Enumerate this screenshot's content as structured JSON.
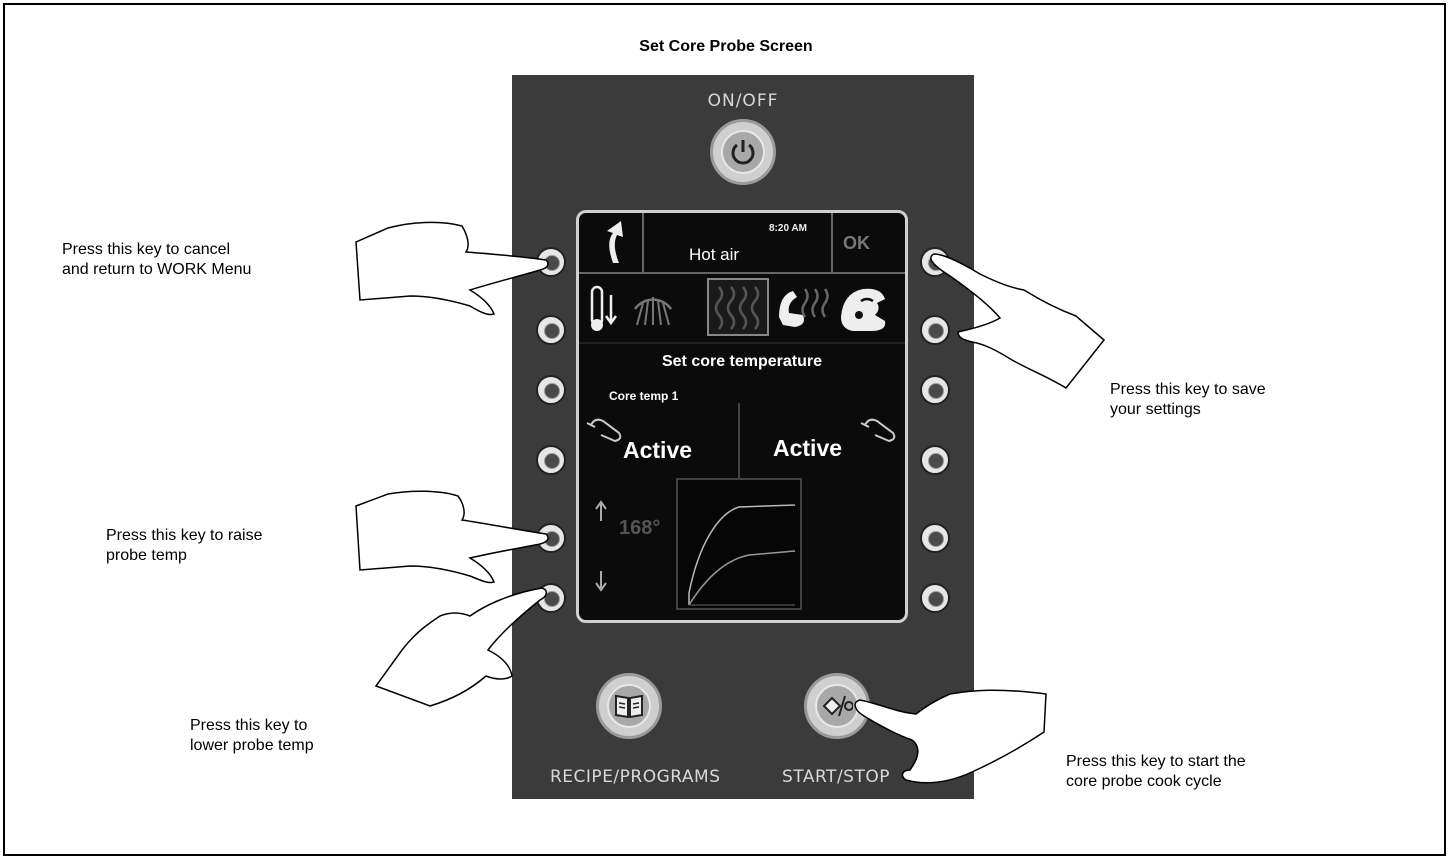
{
  "title": "Set Core Probe Screen",
  "panel": {
    "on_off_label": "ON/OFF",
    "recipe_label": "RECIPE/PROGRAMS",
    "start_stop_label": "START/STOP"
  },
  "screen": {
    "time": "8:20 AM",
    "mode": "Hot air",
    "ok_label": "OK",
    "heading": "Set core temperature",
    "probe_label": "Core temp 1",
    "status_left": "Active",
    "status_right": "Active",
    "temperature": "168°"
  },
  "notes": {
    "cancel_line1": "Press this key to cancel",
    "cancel_line2": "and return to WORK Menu",
    "save_line1": "Press this key to save",
    "save_line2": "your settings",
    "raise_line1": "Press this key to raise",
    "raise_line2": "probe temp",
    "lower_line1": "Press this key to",
    "lower_line2": "lower probe temp",
    "start_line1": "Press this key to start the",
    "start_line2": "core probe cook cycle"
  }
}
